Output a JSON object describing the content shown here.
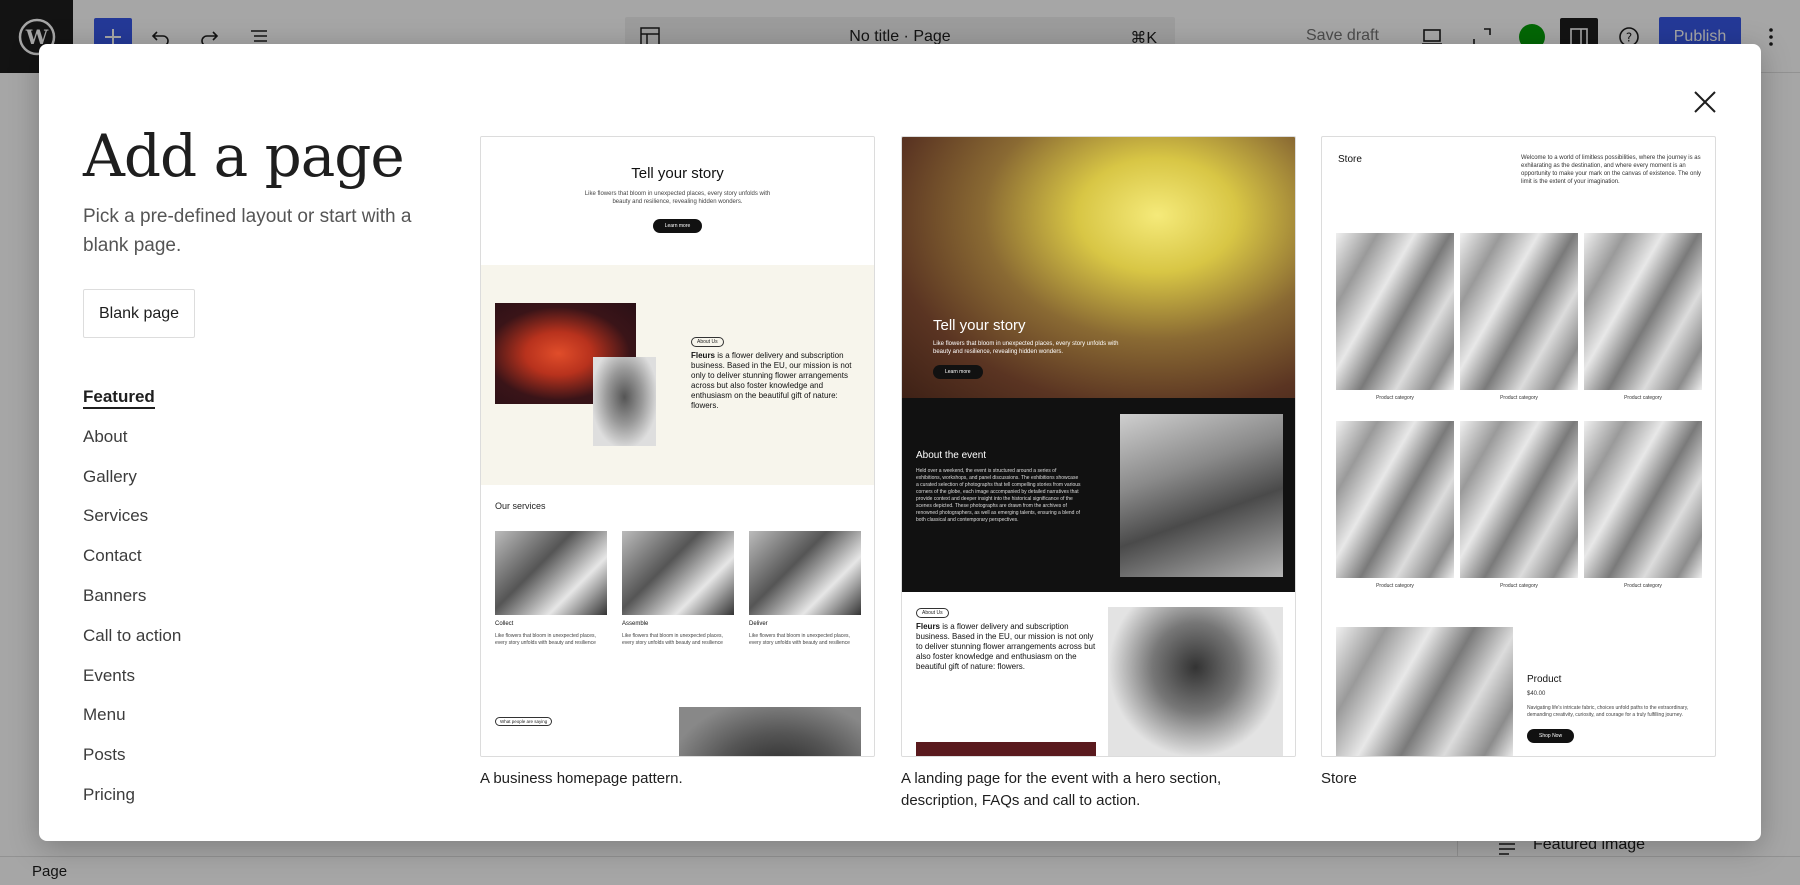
{
  "editor": {
    "doc_title": "No title · Page",
    "shortcut": "⌘K",
    "save_draft": "Save draft",
    "publish": "Publish",
    "statusbar": "Page",
    "sidebar_featured_image": "Featured image"
  },
  "modal": {
    "title": "Add a page",
    "description": "Pick a pre-defined layout or start with a blank page.",
    "blank_button": "Blank page",
    "categories": [
      "Featured",
      "About",
      "Gallery",
      "Services",
      "Contact",
      "Banners",
      "Call to action",
      "Events",
      "Menu",
      "Posts",
      "Pricing"
    ],
    "active_category": "Featured",
    "patterns": [
      {
        "label": "A business homepage pattern.",
        "preview": {
          "hero_title": "Tell your story",
          "hero_text": "Like flowers that bloom in unexpected places, every story unfolds with beauty and resilience, revealing hidden wonders.",
          "hero_button": "Learn more",
          "about_tag": "About Us",
          "about_brand": "Fleurs",
          "about_text": " is a flower delivery and subscription business. Based in the EU, our mission is not only to deliver stunning flower arrangements across but also foster knowledge and enthusiasm on the beautiful gift of nature: flowers.",
          "services_title": "Our services",
          "services": [
            {
              "title": "Collect",
              "text": "Like flowers that bloom in unexpected places, every story unfolds with beauty and resilience"
            },
            {
              "title": "Assemble",
              "text": "Like flowers that bloom in unexpected places, every story unfolds with beauty and resilience"
            },
            {
              "title": "Deliver",
              "text": "Like flowers that bloom in unexpected places, every story unfolds with beauty and resilience"
            }
          ],
          "testimonial_tag": "What people are saying"
        }
      },
      {
        "label": "A landing page for the event with a hero section, description, FAQs and call to action.",
        "preview": {
          "hero_title": "Tell your story",
          "hero_text": "Like flowers that bloom in unexpected places, every story unfolds with beauty and resilience, revealing hidden wonders.",
          "hero_button": "Learn more",
          "event_title": "About the event",
          "event_text": "Held over a weekend, the event is structured around a series of exhibitions, workshops, and panel discussions. The exhibitions showcase a curated selection of photographs that tell compelling stories from various corners of the globe, each image accompanied by detailed narratives that provide context and deeper insight into the historical significance of the scenes depicted. These photographs are drawn from the archives of renowned photographers, as well as emerging talents, ensuring a blend of both classical and contemporary perspectives.",
          "about_tag": "About Us",
          "about_brand": "Fleurs",
          "about_text": " is a flower delivery and subscription business. Based in the EU, our mission is not only to deliver stunning flower arrangements across but also foster knowledge and enthusiasm on the beautiful gift of nature: flowers."
        }
      },
      {
        "label": "Store",
        "preview": {
          "store_title": "Store",
          "intro": "Welcome to a world of limitless possibilities, where the journey is as exhilarating as the destination, and where every moment is an opportunity to make your mark on the canvas of existence. The only limit is the extent of your imagination.",
          "category_caption": "Product category",
          "product_title": "Product",
          "product_price": "$40.00",
          "product_text": "Navigating life's intricate fabric, choices unfold paths to the extraordinary, demanding creativity, curiosity, and courage for a truly fulfilling journey.",
          "product_button": "Shop Now"
        }
      }
    ]
  },
  "colors": {
    "accent": "#3858e9",
    "dark": "#1e1e1e",
    "overlay": "rgba(0,0,0,0.35)"
  },
  "icons": [
    "wordpress-logo-icon",
    "plus-icon",
    "undo-icon",
    "redo-icon",
    "list-view-icon",
    "page-icon",
    "desktop-preview-icon",
    "fullscreen-icon",
    "jetpack-icon",
    "settings-sidebar-icon",
    "help-icon",
    "more-options-icon",
    "close-icon",
    "featured-image-icon"
  ]
}
